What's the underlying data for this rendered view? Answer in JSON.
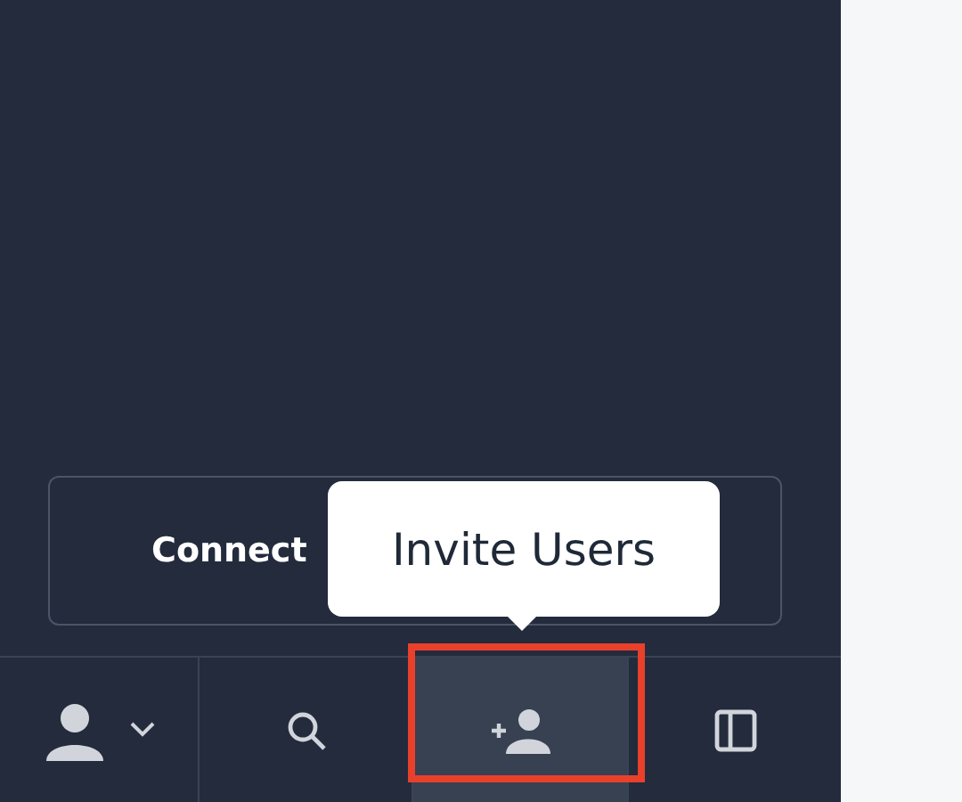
{
  "connect_button": {
    "label": "Connect"
  },
  "tooltip": {
    "text": "Invite Users"
  },
  "toolbar": [
    {
      "kind": "account",
      "selected": false,
      "highlighted": false
    },
    {
      "kind": "search",
      "selected": false,
      "highlighted": false
    },
    {
      "kind": "invite",
      "selected": true,
      "highlighted": true
    },
    {
      "kind": "sidebar",
      "selected": false,
      "highlighted": false
    }
  ]
}
